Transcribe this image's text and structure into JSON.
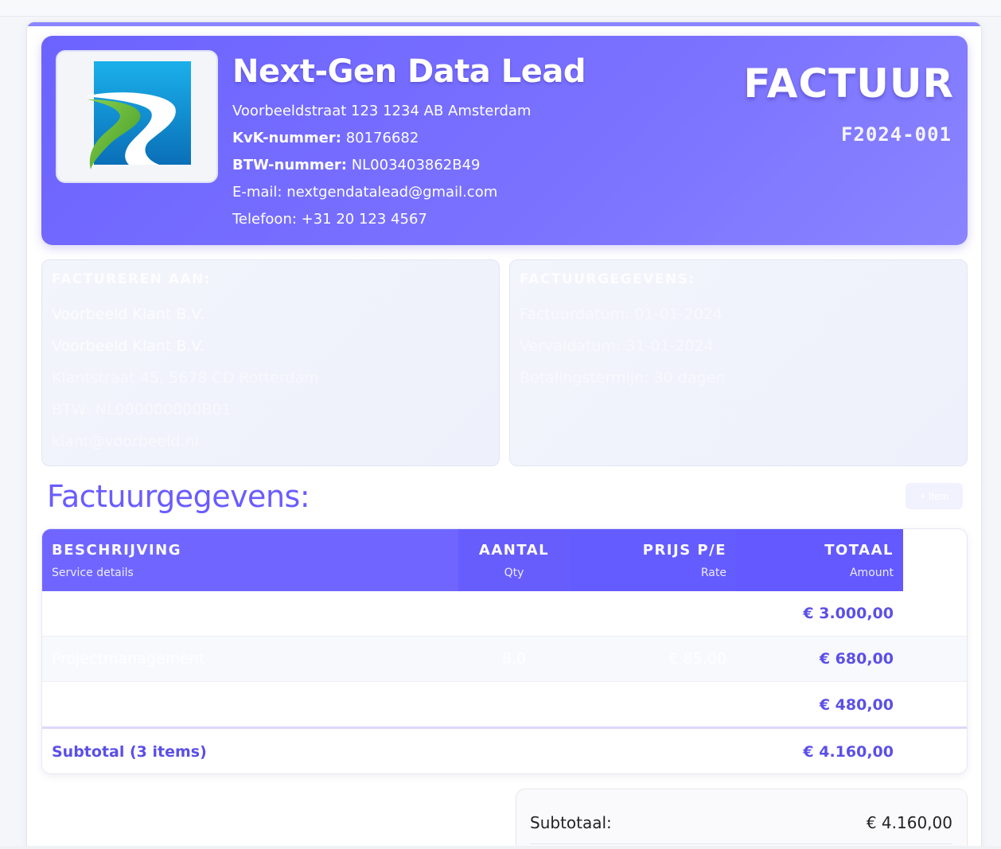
{
  "company": {
    "name": "Next-Gen Data Lead",
    "address": "Voorbeeldstraat 123 1234 AB Amsterdam",
    "kvk_label": "KvK-nummer:",
    "kvk_value": "80176682",
    "btw_label": "BTW-nummer:",
    "btw_value": "NL003403862B49",
    "email_line": "E-mail: nextgendatalead@gmail.com",
    "phone_line": "Telefoon: +31 20 123 4567"
  },
  "invoice": {
    "title": "FACTUUR",
    "number": "F2024-001"
  },
  "bill_to": {
    "title": "FACTUREREN AAN:",
    "lines": [
      "Voorbeeld Klant B.V.",
      "Voorbeeld Klant B.V.",
      "Klantstraat 45, 5678 CD Rotterdam",
      "BTW: NL000000000B01",
      "klant@voorbeeld.nl"
    ]
  },
  "invoice_details": {
    "title": "FACTUURGEGEVENS:",
    "lines": [
      "Factuurdatum: 01-01-2024",
      "Vervaldatum: 31-01-2024",
      "Betalingstermijn: 30 dagen"
    ]
  },
  "section": {
    "title": "Factuurgegevens:",
    "button_label": "+ Item"
  },
  "table": {
    "headers": [
      {
        "main": "BESCHRIJVING",
        "sub": "Service details"
      },
      {
        "main": "AANTAL",
        "sub": "Qty"
      },
      {
        "main": "PRIJS P/E",
        "sub": "Rate"
      },
      {
        "main": "TOTAAL",
        "sub": "Amount"
      }
    ],
    "rows": [
      {
        "description": "",
        "qty": "",
        "rate": "",
        "total": "€ 3.000,00"
      },
      {
        "description": "Projectmanagement",
        "qty": "8,0",
        "rate": "€ 85,00",
        "total": "€ 680,00"
      },
      {
        "description": "",
        "qty": "",
        "rate": "",
        "total": "€ 480,00"
      }
    ],
    "subtotal_label": "Subtotal (3 items)",
    "subtotal_value": "€ 4.160,00"
  },
  "totals": {
    "subtotal_label": "Subtotaal:",
    "subtotal_value": "€ 4.160,00"
  },
  "colors": {
    "accent": "#6c63ff",
    "accent_text": "#5b4fe8",
    "logo_blue": "#1a8fd8",
    "logo_green": "#6cbf3a"
  }
}
